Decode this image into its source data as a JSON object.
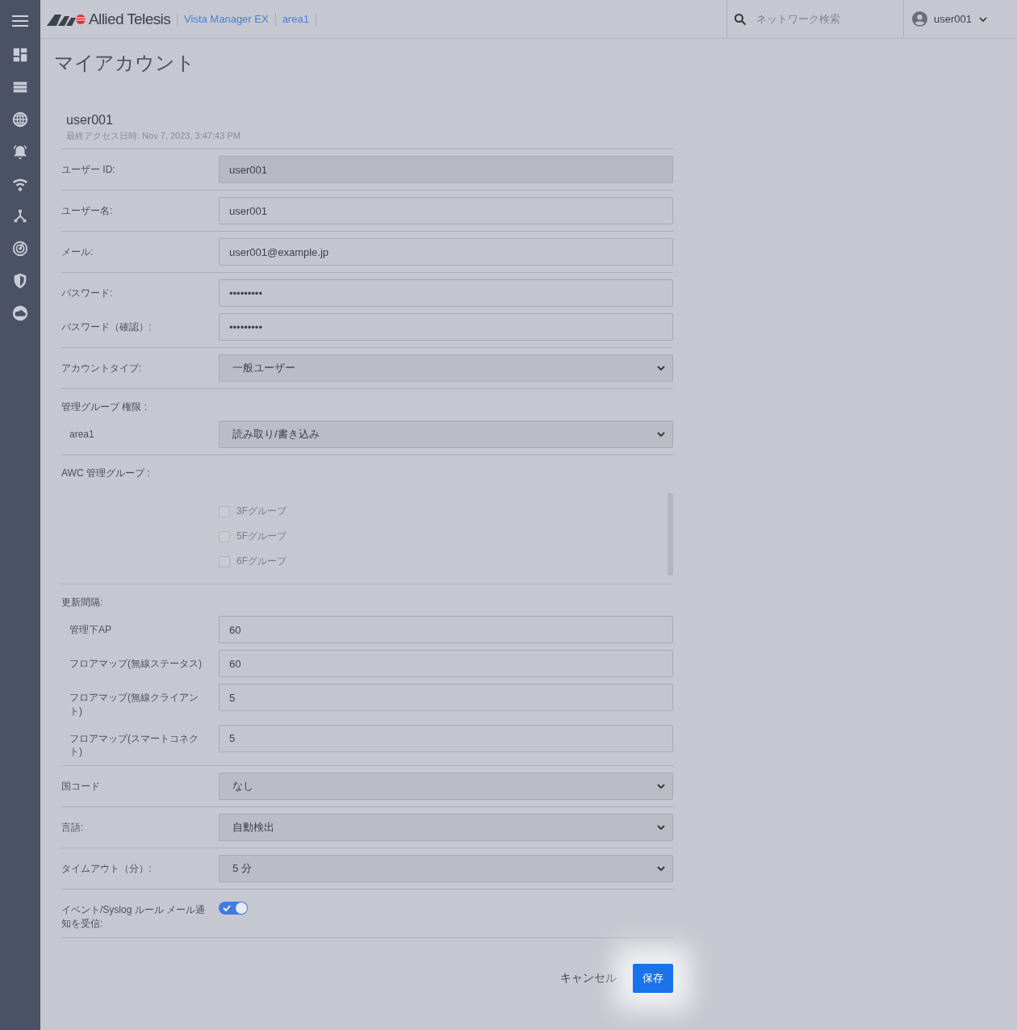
{
  "header": {
    "logo": "Allied Telesis",
    "breadcrumbs": [
      "Vista Manager EX",
      "area1"
    ],
    "search": {
      "placeholder": "ネットワーク検索"
    },
    "user": "user001"
  },
  "page_title": "マイアカウント",
  "profile": {
    "name": "user001",
    "last_access": "最終アクセス日時: Nov 7, 2023, 3:47:43 PM"
  },
  "sections": [
    {
      "rows": [
        {
          "kind": "input",
          "label": "ユーザー ID:",
          "value": "user001",
          "disabled": true
        }
      ]
    },
    {
      "rows": [
        {
          "kind": "input",
          "label": "ユーザー名:",
          "value": "user001",
          "disabled": false
        }
      ]
    },
    {
      "rows": [
        {
          "kind": "input",
          "label": "メール:",
          "value": "user001@example.jp",
          "disabled": false
        }
      ]
    },
    {
      "rows": [
        {
          "kind": "input",
          "label": "パスワード:",
          "value": "•••••••••",
          "disabled": false
        },
        {
          "kind": "input",
          "label": "パスワード（確認）:",
          "value": "•••••••••",
          "disabled": false
        }
      ]
    },
    {
      "rows": [
        {
          "kind": "select",
          "label": "アカウントタイプ:",
          "value": "一般ユーザー"
        }
      ]
    },
    {
      "heading": "管理グループ 権限 :",
      "rows": [
        {
          "kind": "select",
          "label": "area1",
          "value": "読み取り/書き込み"
        }
      ]
    },
    {
      "heading": "AWC 管理グループ :",
      "rows": [
        {
          "kind": "checklist",
          "items": [
            {
              "label": "3Fグループ",
              "checked": false,
              "disabled": true
            },
            {
              "label": "5Fグループ",
              "checked": false,
              "disabled": true
            },
            {
              "label": "6Fグループ",
              "checked": false,
              "disabled": true
            }
          ]
        }
      ]
    },
    {
      "heading": "更新間隔:",
      "rows": [
        {
          "kind": "input",
          "label": "管理下AP",
          "value": "60",
          "disabled": false
        },
        {
          "kind": "input",
          "label": "フロアマップ(無線ステータス)",
          "value": "60",
          "disabled": false
        },
        {
          "kind": "input",
          "label": "フロアマップ(無線クライアント)",
          "value": "5",
          "disabled": false
        },
        {
          "kind": "input",
          "label": "フロアマップ(スマートコネクト)",
          "value": "5",
          "disabled": false
        }
      ]
    },
    {
      "rows": [
        {
          "kind": "select",
          "label": "国コード",
          "value": "なし"
        }
      ]
    },
    {
      "rows": [
        {
          "kind": "select",
          "label": "言語:",
          "value": "自動検出"
        }
      ]
    },
    {
      "rows": [
        {
          "kind": "select",
          "label": "タイムアウト（分）:",
          "value": "5 分"
        }
      ]
    },
    {
      "rows": [
        {
          "kind": "toggle",
          "label": "イベント/Syslog ルール メール通知を受信:",
          "on": true
        }
      ]
    }
  ],
  "buttons": {
    "cancel": "キャンセル",
    "save": "保存"
  }
}
